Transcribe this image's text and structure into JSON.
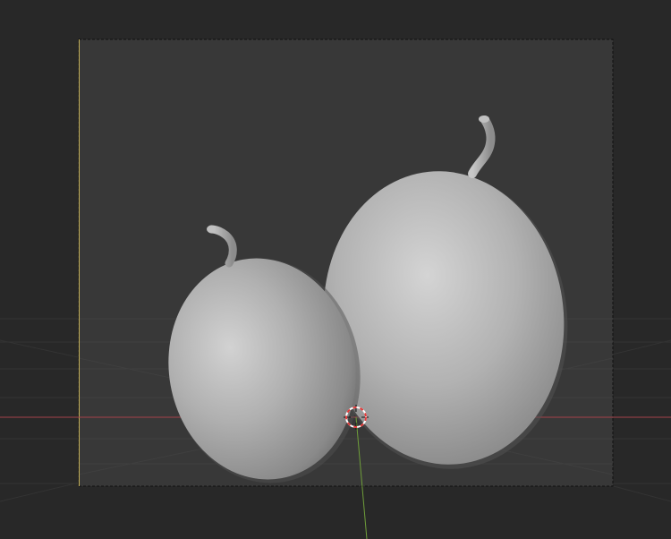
{
  "viewport": {
    "objects": [
      "small-gourd",
      "large-gourd"
    ],
    "colors": {
      "background": "#282828",
      "camera_frame": "#383838",
      "frame_border": "#111111",
      "frame_left_edge": "#c8b45a",
      "x_axis": "#a4424a",
      "y_axis": "#6f9e3a",
      "cursor_red": "#e23a3a",
      "cursor_white": "#ffffff",
      "grid": "#3a3a3a",
      "mesh_light": "#d4d4d4",
      "mesh_base": "#9c9c9c",
      "mesh_dark": "#5e5e5e"
    },
    "icons": [
      "3d-cursor-icon"
    ]
  }
}
